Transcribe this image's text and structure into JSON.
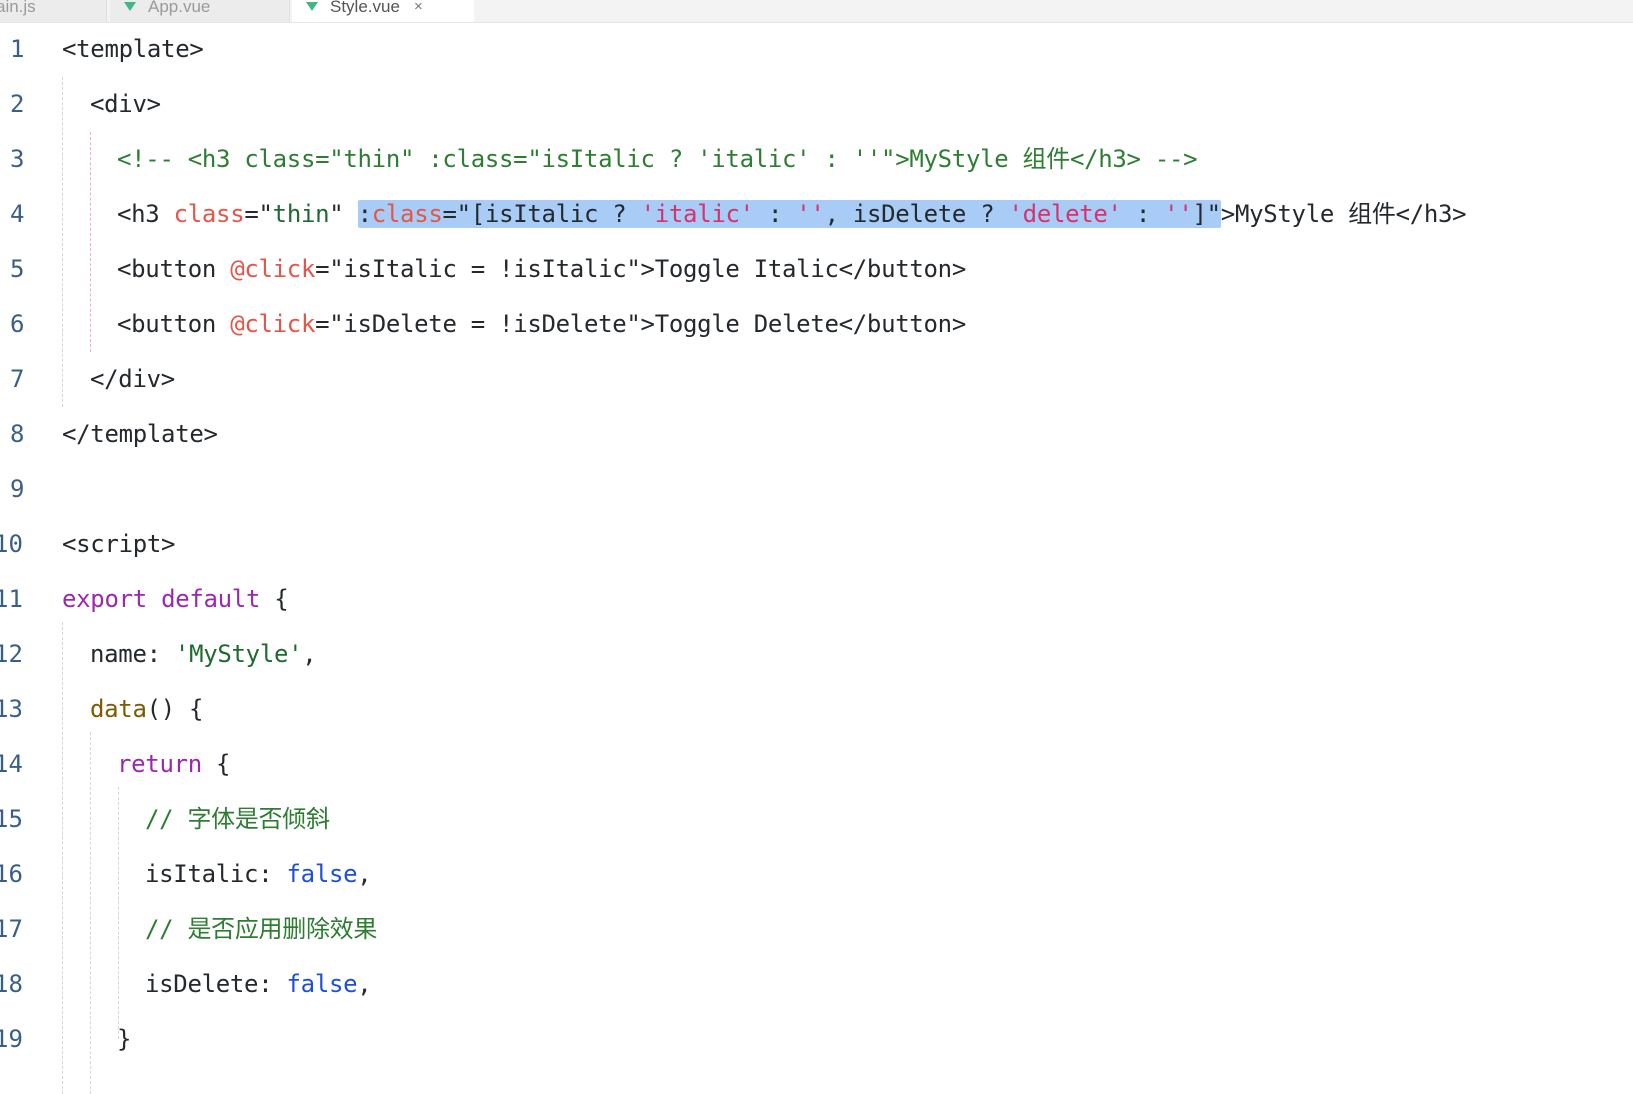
{
  "tabs": [
    {
      "label": "ain.js",
      "has_icon": false
    },
    {
      "label": "App.vue",
      "has_icon": true
    },
    {
      "label": "Style.vue",
      "has_icon": true,
      "active": true,
      "close": "×"
    }
  ],
  "colors": {
    "tag": "#24292e",
    "attribute": "#e45649",
    "string": "#1f6b2f",
    "string_literal": "#d6336c",
    "comment": "#2e7d32",
    "keyword": "#9c27b0",
    "boolean": "#1e4fd8",
    "selection": "#a8ccf5",
    "line_number": "#3a5f86",
    "vue_icon": "#41b883"
  },
  "lines": [
    {
      "n": "1",
      "t": [
        "<template>"
      ]
    },
    {
      "n": "2",
      "t": [
        "<div>"
      ]
    },
    {
      "n": "3",
      "t": [
        "<!-- <h3 class=\"thin\" :class=\"isItalic ? 'italic' : ''\">MyStyle 组件</h3> -->"
      ]
    },
    {
      "n": "4",
      "t": [
        "<h3 ",
        "class",
        "=\"",
        "thin",
        "\" ",
        ":",
        "class",
        "=\"[isItalic ? ",
        "'italic'",
        " : ",
        "''",
        ", isDelete ? ",
        "'delete'",
        " : ",
        "''",
        "]\"",
        ">MyStyle 组件</h3>"
      ]
    },
    {
      "n": "5",
      "t": [
        "<button ",
        "@click",
        "=\"isItalic = !isItalic\">Toggle Italic</button>"
      ]
    },
    {
      "n": "6",
      "t": [
        "<button ",
        "@click",
        "=\"isDelete = !isDelete\">Toggle Delete</button>"
      ]
    },
    {
      "n": "7",
      "t": [
        "</div>"
      ]
    },
    {
      "n": "8",
      "t": [
        "</template>"
      ]
    },
    {
      "n": "9",
      "t": [
        ""
      ]
    },
    {
      "n": "10",
      "t": [
        "<script>"
      ]
    },
    {
      "n": "11",
      "t": [
        "export",
        " ",
        "default",
        " {"
      ]
    },
    {
      "n": "12",
      "t": [
        "name",
        ": ",
        "'MyStyle'",
        ","
      ]
    },
    {
      "n": "13",
      "t": [
        "data",
        "() {"
      ]
    },
    {
      "n": "14",
      "t": [
        "return",
        " {"
      ]
    },
    {
      "n": "15",
      "t": [
        "// 字体是否倾斜"
      ]
    },
    {
      "n": "16",
      "t": [
        "isItalic",
        ": ",
        "false",
        ","
      ]
    },
    {
      "n": "17",
      "t": [
        "// 是否应用删除效果"
      ]
    },
    {
      "n": "18",
      "t": [
        "isDelete",
        ": ",
        "false",
        ","
      ]
    },
    {
      "n": "19",
      "t": [
        "}"
      ]
    }
  ]
}
